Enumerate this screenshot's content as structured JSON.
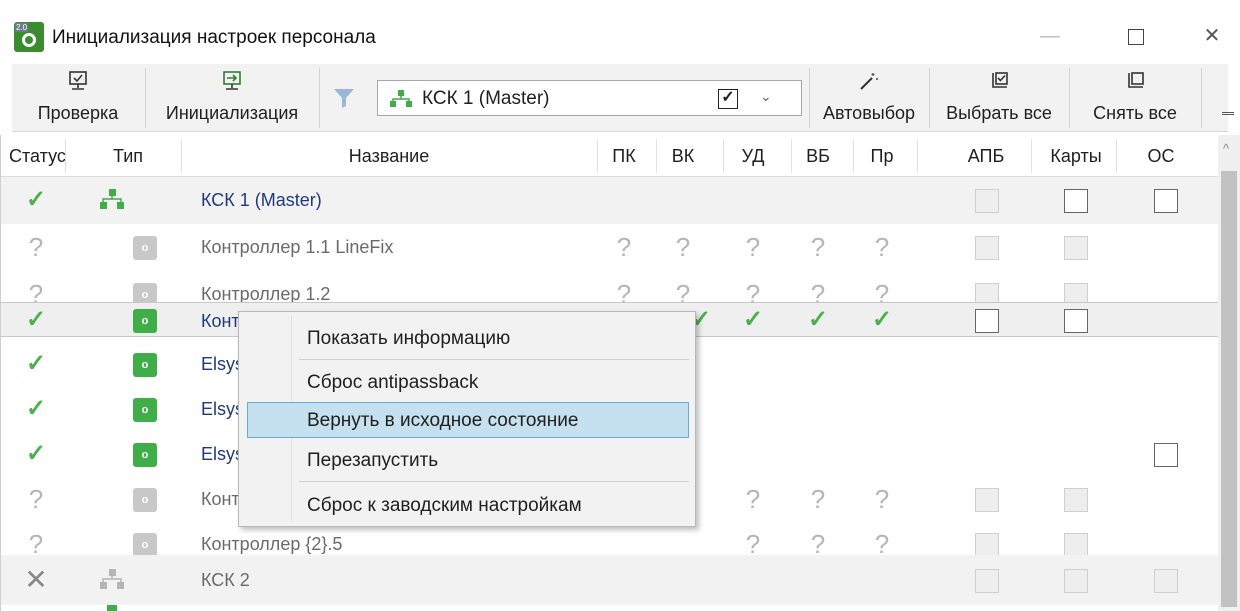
{
  "window": {
    "title": "Инициализация настроек персонала",
    "app_icon_badge": "2.0",
    "minimize": "—",
    "close": "✕"
  },
  "toolbar": {
    "check_label": "Проверка",
    "init_label": "Инициализация",
    "device_selector": "КСК 1 (Master)",
    "device_checked": "✓",
    "dropdown_arrow": "⌄",
    "autoselect_label": "Автовыбор",
    "select_all_label": "Выбрать все",
    "deselect_all_label": "Снять все"
  },
  "grid": {
    "columns": [
      "Статус",
      "Тип",
      "Название",
      "ПК",
      "ВК",
      "УД",
      "ВБ",
      "Пр",
      "АПБ",
      "Карты",
      "ОС"
    ],
    "rows": [
      {
        "status": "ok",
        "type": "network",
        "name": "КСК 1 (Master)"
      },
      {
        "status": "unknown",
        "type": "controller",
        "name": "Контроллер 1.1 LineFix",
        "flags": "?"
      },
      {
        "status": "unknown",
        "type": "controller",
        "name": "Контроллер 1.2",
        "flags": "?"
      },
      {
        "status": "ok",
        "type": "controller",
        "name": "Конт",
        "flags": "✓"
      },
      {
        "status": "ok",
        "type": "controller",
        "name": "Elsys"
      },
      {
        "status": "ok",
        "type": "controller",
        "name": "Elsys"
      },
      {
        "status": "ok",
        "type": "controller",
        "name": "Elsys"
      },
      {
        "status": "unknown",
        "type": "controller",
        "name": "Конт",
        "flags": "?"
      },
      {
        "status": "unknown",
        "type": "controller",
        "name": "Контроллер {2}.5",
        "flags": "?"
      },
      {
        "status": "error",
        "type": "network",
        "name": "КСК 2"
      }
    ]
  },
  "glyphs": {
    "ok": "✓",
    "unknown": "?",
    "error": "✕",
    "dev": "o",
    "scroll_up": "^"
  },
  "context_menu": {
    "items": [
      "Показать информацию",
      "Сброс antipassback",
      "Вернуть в исходное состояние",
      "Перезапустить",
      "Сброс к заводским настройкам"
    ],
    "highlighted_index": 2
  },
  "colors": {
    "ok": "#4caf50",
    "device_active": "#3fae49",
    "highlight": "#c5e0ef",
    "link": "#1f3a7a"
  }
}
